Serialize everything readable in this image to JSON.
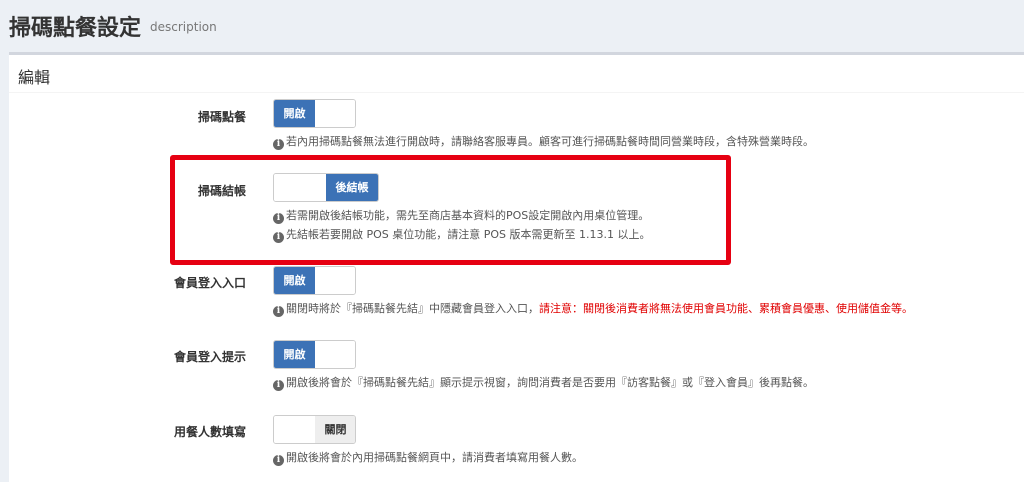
{
  "header": {
    "title": "掃碼點餐設定",
    "description": "description"
  },
  "panel": {
    "title": "編輯"
  },
  "settings": [
    {
      "label": "掃碼點餐",
      "toggle_on_label": "開啟",
      "state": "on",
      "help": [
        "若內用掃碼點餐無法進行開啟時，請聯絡客服專員。顧客可進行掃碼點餐時間同營業時段，含特殊營業時段。"
      ]
    },
    {
      "label": "掃碼結帳",
      "toggle_on_label": "後結帳",
      "state": "right",
      "help": [
        "若需開啟後結帳功能，需先至商店基本資料的POS設定開啟內用桌位管理。",
        "先結帳若要開啟 POS 桌位功能，請注意 POS 版本需更新至 1.13.1 以上。"
      ]
    },
    {
      "label": "會員登入入口",
      "toggle_on_label": "開啟",
      "state": "on",
      "help": [
        "關閉時將於『掃碼點餐先結』中隱藏會員登入入口，"
      ],
      "warning": "請注意：關閉後消費者將無法使用會員功能、累積會員優惠、使用儲值金等。"
    },
    {
      "label": "會員登入提示",
      "toggle_on_label": "開啟",
      "state": "on",
      "help": [
        "開啟後將會於『掃碼點餐先結』顯示提示視窗，詢問消費者是否要用『訪客點餐』或『登入會員』後再點餐。"
      ]
    },
    {
      "label": "用餐人數填寫",
      "toggle_off_label": "關閉",
      "state": "off",
      "help": [
        "開啟後將會於內用掃碼點餐網頁中，請消費者填寫用餐人數。"
      ]
    }
  ],
  "colors": {
    "toggle_on": "#3c72b6",
    "highlight_border": "#e60012",
    "warning_text": "#e00000"
  },
  "icons": {
    "help": "info-circle-icon"
  }
}
